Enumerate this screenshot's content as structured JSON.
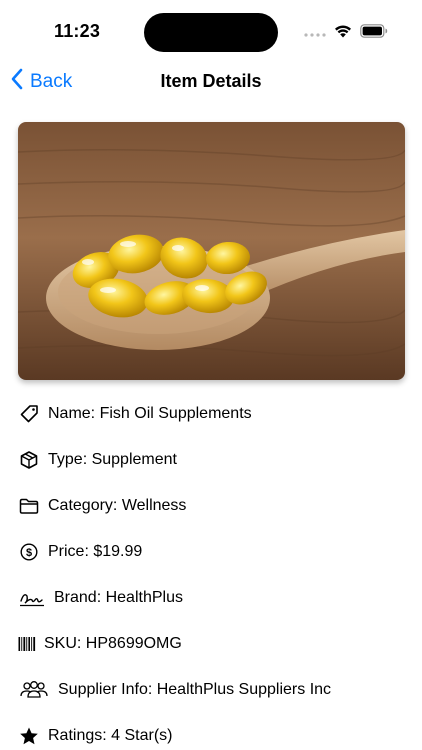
{
  "status_bar": {
    "time": "11:23",
    "icons": [
      "signal-dots-icon",
      "wifi-icon",
      "battery-icon"
    ]
  },
  "nav": {
    "back_label": "Back",
    "title": "Item Details"
  },
  "accent_color": "#0a7aff",
  "hero_image": {
    "subject": "fish oil capsules on wooden spoon",
    "icon": "photo"
  },
  "details": [
    {
      "icon": "tag-icon",
      "text": "Name: Fish Oil Supplements"
    },
    {
      "icon": "box-icon",
      "text": "Type: Supplement"
    },
    {
      "icon": "folder-icon",
      "text": "Category: Wellness"
    },
    {
      "icon": "dollar-circle-icon",
      "text": "Price: $19.99"
    },
    {
      "icon": "signature-icon",
      "text": "Brand: HealthPlus"
    },
    {
      "icon": "barcode-icon",
      "text": "SKU: HP8699OMG"
    },
    {
      "icon": "people-icon",
      "text": "Supplier Info: HealthPlus Suppliers Inc"
    },
    {
      "icon": "star-icon",
      "text": "Ratings: 4 Star(s)"
    }
  ]
}
